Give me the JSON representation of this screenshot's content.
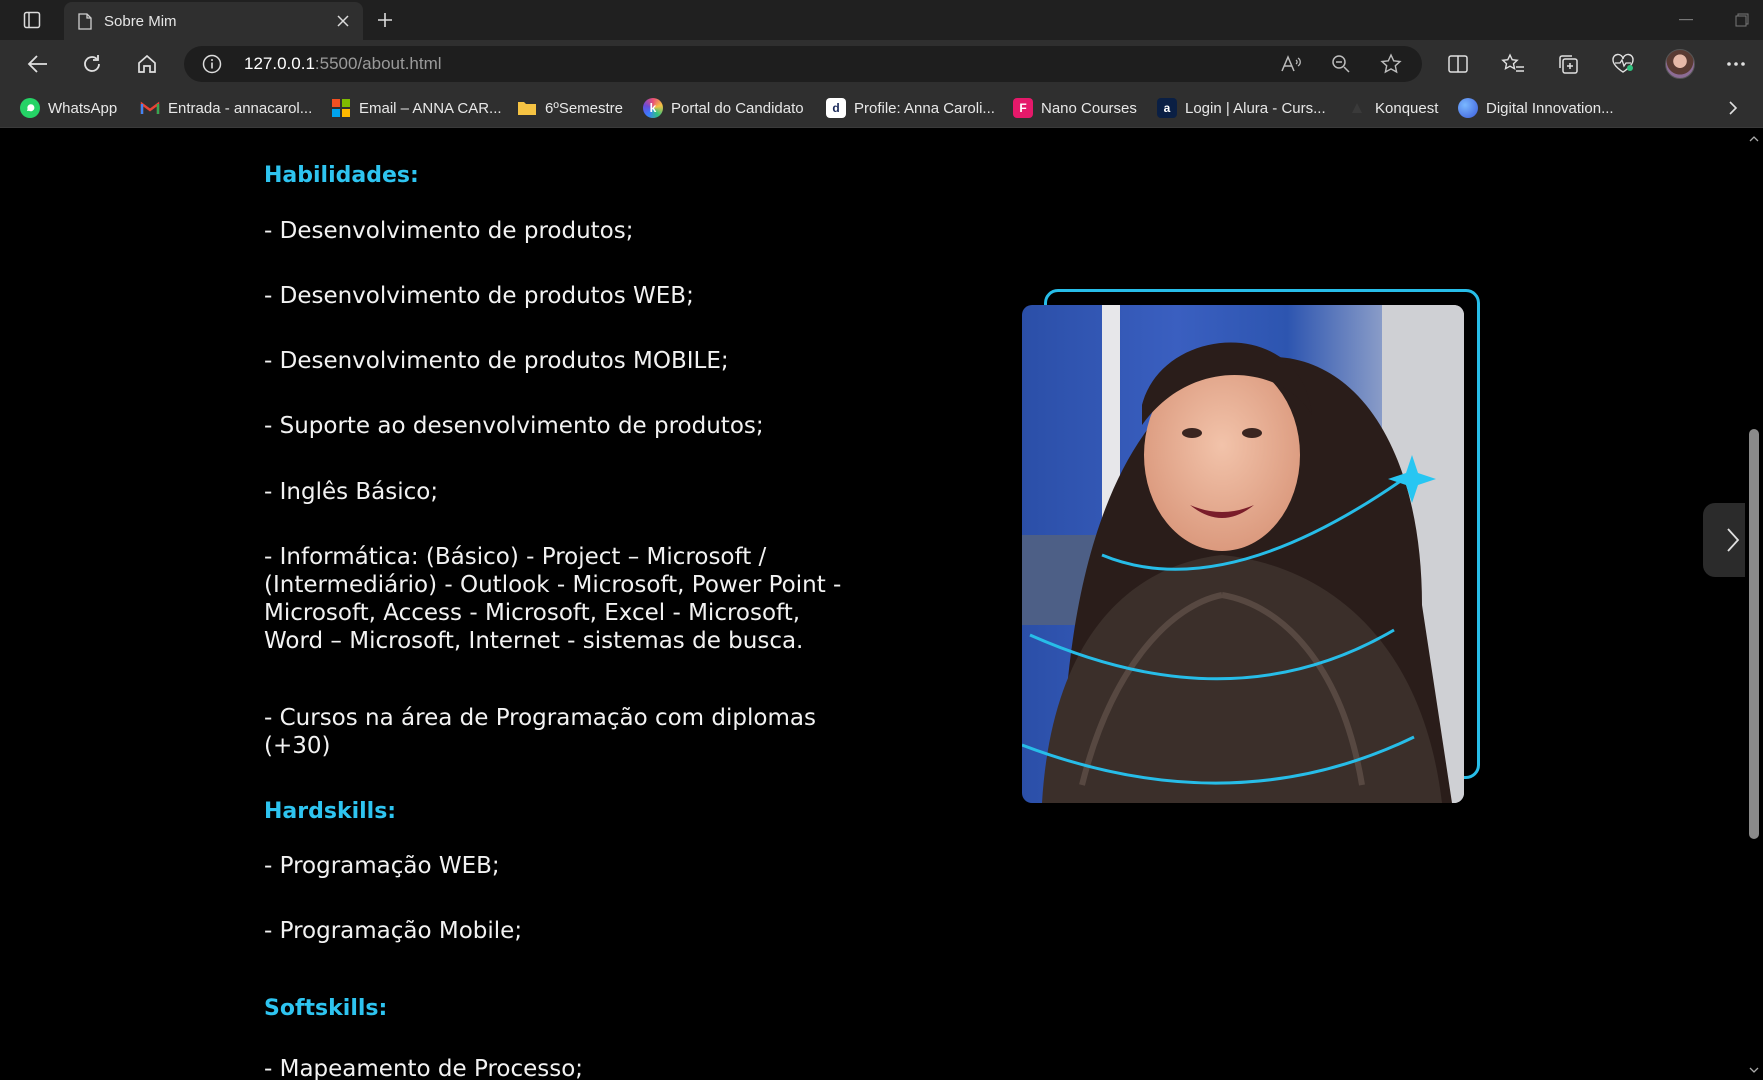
{
  "tab": {
    "title": "Sobre Mim"
  },
  "address": {
    "host": "127.0.0.1",
    "rest": ":5500/about.html"
  },
  "bookmarks": [
    {
      "label": "WhatsApp",
      "icon": "whatsapp-icon",
      "color": "#25d366"
    },
    {
      "label": "Entrada - annacarol...",
      "icon": "gmail-icon",
      "color": "#ea4335"
    },
    {
      "label": "Email – ANNA CAR...",
      "icon": "microsoft-icon",
      "color": "#f25022"
    },
    {
      "label": "6ºSemestre",
      "icon": "folder-icon",
      "color": "#f6c343"
    },
    {
      "label": "Portal do Candidato",
      "icon": "portal-icon",
      "color": "#6c4bd6"
    },
    {
      "label": "Profile: Anna Caroli...",
      "icon": "dio-icon",
      "color": "#ffffff"
    },
    {
      "label": "Nano Courses",
      "icon": "nano-icon",
      "color": "#e5196a"
    },
    {
      "label": "Login | Alura - Curs...",
      "icon": "alura-icon",
      "color": "#0a1f44"
    },
    {
      "label": "Konquest",
      "icon": "konquest-icon",
      "color": "#333333"
    },
    {
      "label": "Digital Innovation...",
      "icon": "dio-circle-icon",
      "color": "#3b7bff"
    }
  ],
  "page": {
    "habilidades_heading": "Habilidades:",
    "habilidades": [
      "- Desenvolvimento de produtos;",
      "- Desenvolvimento de produtos WEB;",
      "- Desenvolvimento de produtos MOBILE;",
      "- Suporte ao desenvolvimento de produtos;",
      "- Inglês Básico;",
      "- Informática: (Básico) - Project – Microsoft / (Intermediário) - Outlook - Microsoft, Power Point - Microsoft, Access - Microsoft, Excel - Microsoft, Word – Microsoft, Internet - sistemas de busca.",
      "- Cursos na área de Programação com diplomas (+30)"
    ],
    "hardskills_heading": "Hardskills:",
    "hardskills": [
      "- Programação WEB;",
      "- Programação Mobile;"
    ],
    "softskills_heading": "Softskills:",
    "softskills": [
      "- Mapeamento de Processo;"
    ]
  },
  "colors": {
    "accent": "#2ec4f0",
    "frame": "#27bde8"
  }
}
